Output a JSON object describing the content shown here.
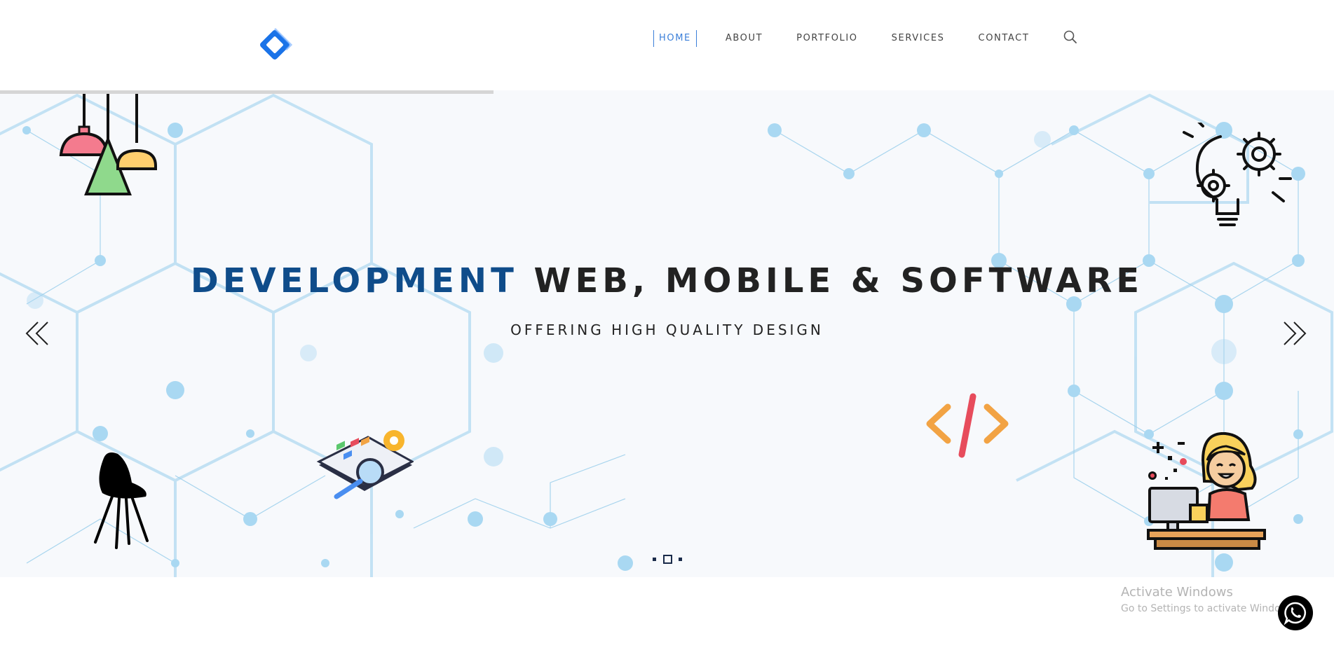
{
  "nav": {
    "items": [
      {
        "label": "HOME",
        "active": true
      },
      {
        "label": "ABOUT",
        "active": false
      },
      {
        "label": "PORTFOLIO",
        "active": false
      },
      {
        "label": "SERVICES",
        "active": false
      },
      {
        "label": "CONTACT",
        "active": false
      }
    ],
    "search_icon": "search-icon"
  },
  "hero": {
    "title_accent": "DEVELOPMENT",
    "title_rest": "WEB, MOBILE & SOFTWARE",
    "subtitle": "OFFERING HIGH QUALITY DESIGN",
    "slides_total": 3,
    "active_slide": 2,
    "prev_icon": "double-chevron-left-icon",
    "next_icon": "double-chevron-right-icon"
  },
  "watermark": {
    "title": "Activate Windows",
    "subtitle": "Go to Settings to activate Windows."
  },
  "colors": {
    "accent": "#0f4c8a",
    "nav_active": "#3b7fd9",
    "text_dark": "#222222",
    "hex_line": "#9fd0ec",
    "logo_blue": "#1a73e8"
  }
}
